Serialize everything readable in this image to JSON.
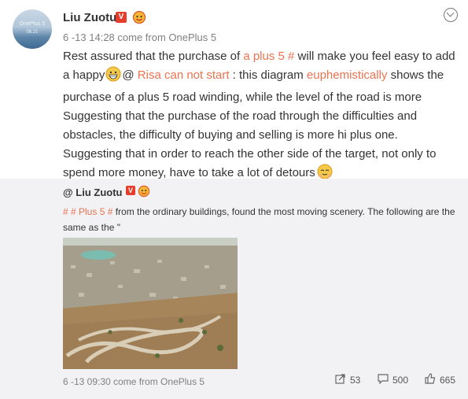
{
  "post": {
    "avatar": {
      "brand": "OnePlus 5",
      "date_caption": "06.21"
    },
    "username": "Liu Zuotu",
    "verified_mark": "V",
    "meta": "6 -13 14:28 come from OnePlus 5",
    "text": {
      "t1": "Rest assured that the purchase of ",
      "link1": "a plus 5 #",
      "t2": " will make you feel easy to add a happy",
      "t3": "@ ",
      "link2": "Risa can not start",
      "t4": " : this diagram ",
      "link3": "euphemistically",
      "t5": " shows the purchase of a plus 5 road winding, while the level of the road is more Suggesting that the purchase of the road through the difficulties and obstacles, the difficulty of buying and selling is more hi plus one. Suggesting that in order to reach the other side of the target, not only to spend more money, have to take a lot of detours"
    }
  },
  "repost": {
    "user": "@ Liu Zuotu",
    "verified_mark": "V",
    "hashtag": "# # Plus 5 #",
    "text": " from the ordinary buildings, found the most moving scenery. The following are the same as the \"",
    "meta": "6 -13 09:30 come from OnePlus 5",
    "actions": {
      "share_count": "53",
      "comment_count": "500",
      "like_count": "665"
    }
  },
  "colors": {
    "link": "#eb7350",
    "verified": "#e63c2c",
    "repost_bg": "#f2f2f5"
  },
  "icons": [
    "chevron-down-icon",
    "grin-emoji-icon",
    "pray-emoji-icon",
    "share-icon",
    "comment-icon",
    "like-icon"
  ]
}
